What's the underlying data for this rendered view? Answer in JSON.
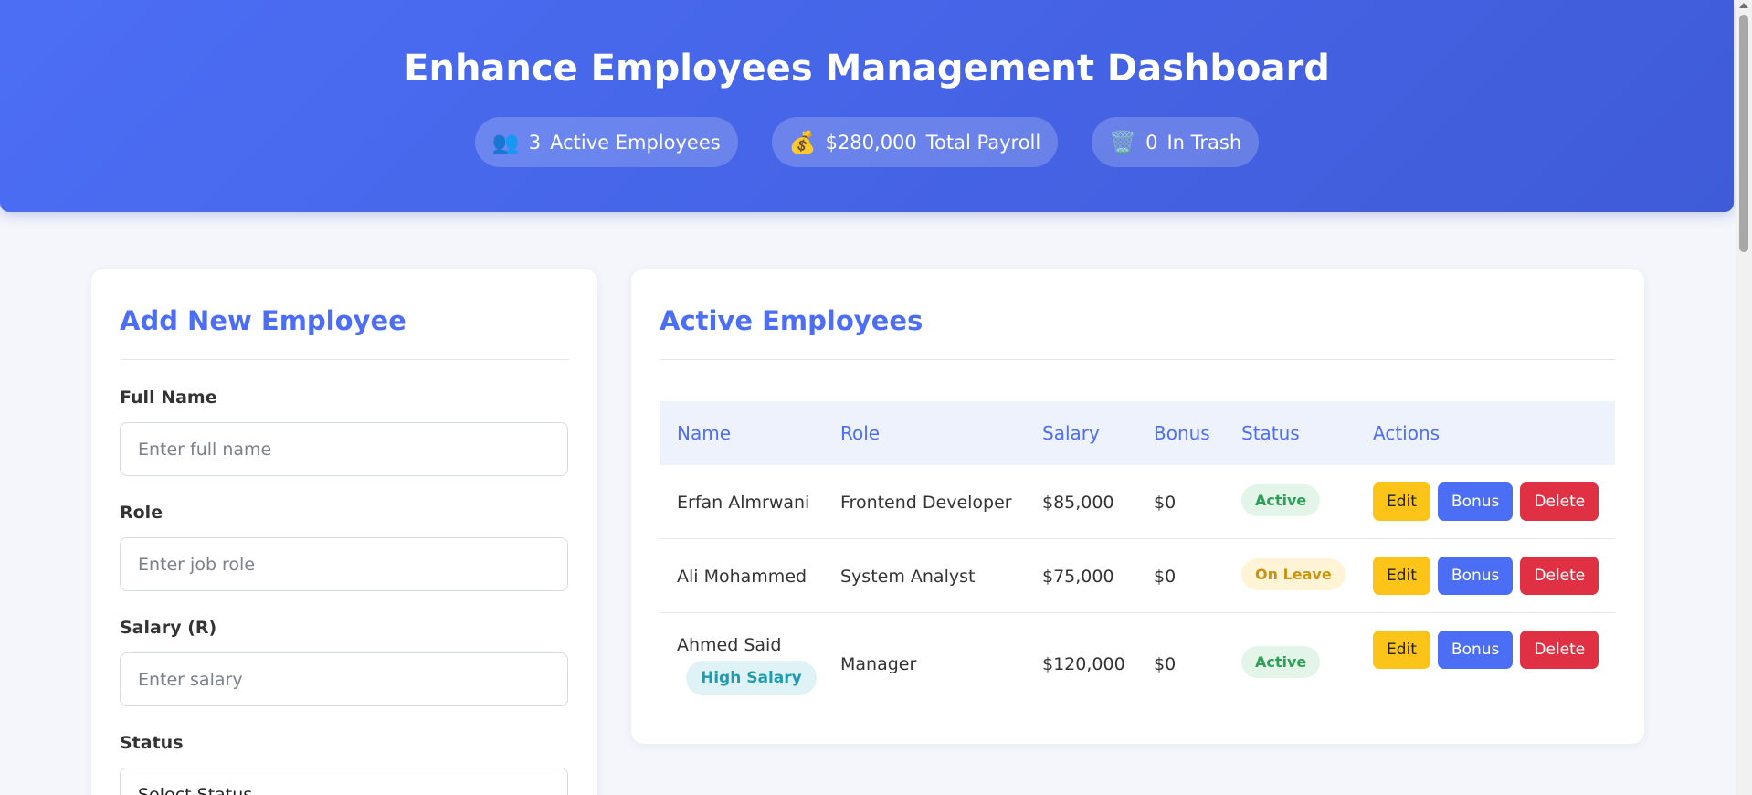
{
  "header": {
    "title": "Enhance Employees Management Dashboard",
    "stats": [
      {
        "icon": "👥",
        "icon_name": "people-icon",
        "value": "3",
        "label": "Active Employees"
      },
      {
        "icon": "💰",
        "icon_name": "money-bag-icon",
        "value": "$280,000",
        "label": "Total Payroll"
      },
      {
        "icon": "🗑️",
        "icon_name": "trash-icon",
        "value": "0",
        "label": "In Trash"
      }
    ]
  },
  "form": {
    "title": "Add New Employee",
    "fields": {
      "name": {
        "label": "Full Name",
        "placeholder": "Enter full name"
      },
      "role": {
        "label": "Role",
        "placeholder": "Enter job role"
      },
      "salary": {
        "label": "Salary (R)",
        "placeholder": "Enter salary"
      },
      "status": {
        "label": "Status",
        "selected": "Select Status"
      }
    }
  },
  "table": {
    "title": "Active Employees",
    "headers": {
      "name": "Name",
      "role": "Role",
      "salary": "Salary",
      "bonus": "Bonus",
      "status": "Status",
      "actions": "Actions"
    },
    "rows": [
      {
        "name": "Erfan Almrwani",
        "role": "Frontend Developer",
        "salary": "$85,000",
        "bonus": "$0",
        "status": "Active",
        "tag": ""
      },
      {
        "name": "Ali Mohammed",
        "role": "System Analyst",
        "salary": "$75,000",
        "bonus": "$0",
        "status": "On Leave",
        "tag": ""
      },
      {
        "name": "Ahmed Said",
        "role": "Manager",
        "salary": "$120,000",
        "bonus": "$0",
        "status": "Active",
        "tag": "High Salary"
      }
    ],
    "actions": {
      "edit": "Edit",
      "bonus": "Bonus",
      "delete": "Delete"
    }
  },
  "colors": {
    "accent": "#4c6ef5",
    "edit": "#fcc419",
    "delete": "#e03144",
    "active": "#2f9e57",
    "leave": "#c99510"
  }
}
